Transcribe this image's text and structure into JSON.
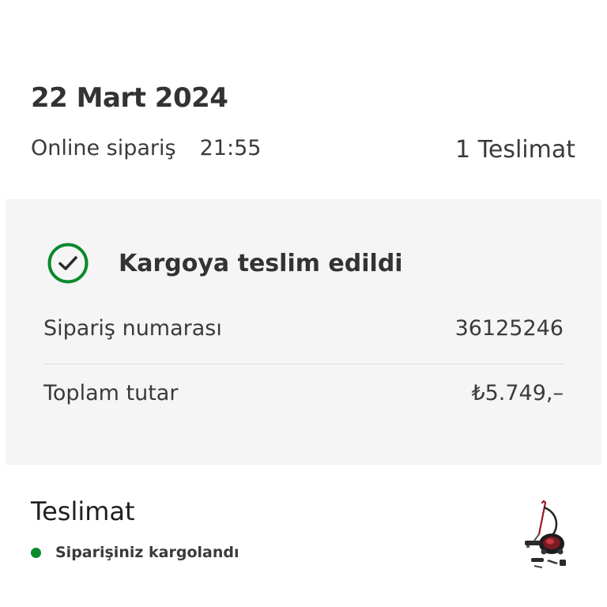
{
  "order": {
    "date": "22 Mart 2024",
    "channel": "Online sipariş",
    "time": "21:55",
    "delivery_count": "1 Teslimat"
  },
  "status_card": {
    "icon": "check-circle-icon",
    "title": "Kargoya teslim edildi",
    "order_number_label": "Sipariş numarası",
    "order_number_value": "36125246",
    "total_label": "Toplam tutar",
    "total_value": "₺5.749,–"
  },
  "delivery": {
    "title": "Teslimat",
    "status_text": "Siparişiniz kargolandı",
    "product_icon": "vacuum-cleaner-thumbnail"
  },
  "colors": {
    "accent_green": "#0a8a2e",
    "card_background": "#f5f5f5"
  }
}
